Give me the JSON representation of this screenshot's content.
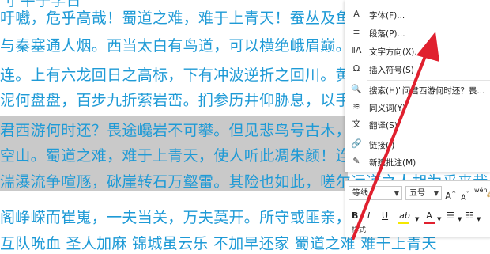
{
  "document": {
    "lines": [
      {
        "text": "刂 平于学日"
      },
      {
        "text": "吁嚱，危乎高哉！蜀道之难，难于上青天！蚕丛及鱼"
      },
      {
        "text": "与秦塞通人烟。西当太白有鸟道，可以横绝峨眉巅。"
      },
      {
        "text": "连。上有六龙回日之高标，下有冲波逆折之回川。黄"
      },
      {
        "text": "泥何盘盘，百步九折萦岩峦。扪参历井仰胁息，以手"
      },
      {
        "text": "君西游何时还？畏途巉岩不可攀。但见悲鸟号古木，"
      },
      {
        "text": "空山。蜀道之难，难于上青天，使人听此凋朱颜！连"
      },
      {
        "text": "湍瀑流争喧豗，砯崖转石万壑雷。其险也如此，嗟尔远道之人胡为乎来哉！"
      },
      {
        "text": "阁峥嵘而崔嵬，一夫当关，万夫莫开。所守或匪亲，"
      },
      {
        "text": "互队吮血 圣人加麻 锦城虽云乐 不加早还家 蜀道之难 难干上青天"
      }
    ]
  },
  "context_menu": {
    "items": [
      {
        "icon": "A",
        "label": "字体(F)..."
      },
      {
        "icon": "≡",
        "label": "段落(P)..."
      },
      {
        "icon": "ⅡA",
        "label": "文字方向(X)..."
      },
      {
        "icon": "Ω",
        "label": "插入符号(S)"
      },
      {
        "icon": "🔍",
        "label": "搜索(H)\"问君西游何时还？畏..."
      },
      {
        "icon": "≋",
        "label": "同义词(Y)"
      },
      {
        "icon": "文",
        "label": "翻译(S)"
      },
      {
        "icon": "🔗",
        "label": "链接(I)"
      },
      {
        "icon": "✎",
        "label": "新建批注(M)"
      }
    ]
  },
  "mini_toolbar": {
    "font_name": "等线",
    "font_size": "五号",
    "grow_font": "A",
    "shrink_font": "A",
    "phonetic": "wén",
    "bold": "B",
    "italic": "I",
    "underline": "U",
    "highlight": "ab",
    "font_color": "A",
    "bullets": "☰",
    "numbering": "☷",
    "styles": "样式"
  },
  "colors": {
    "text": "#1e9ad6",
    "selection": "#c9c9c9",
    "arrow": "#e0202e",
    "font_color_bar": "#e0202e",
    "highlight_bar": "#f5e800"
  }
}
